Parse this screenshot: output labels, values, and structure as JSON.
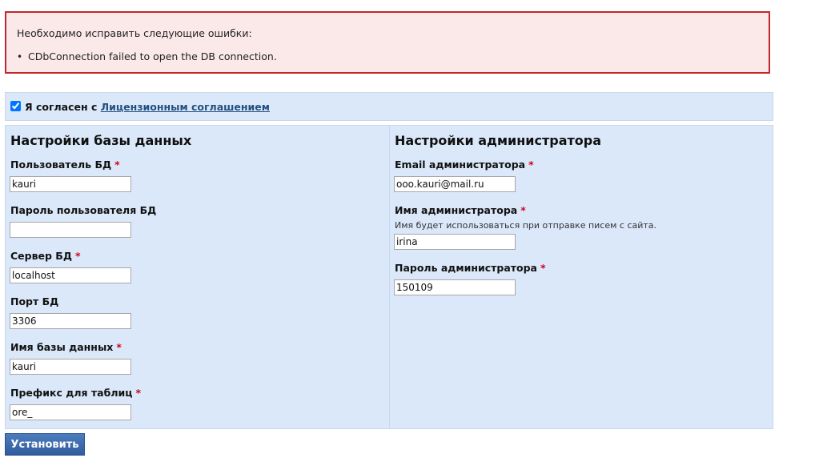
{
  "errors": {
    "title": "Необходимо исправить следующие ошибки:",
    "items": [
      "CDbConnection failed to open the DB connection."
    ]
  },
  "agreement": {
    "checked": true,
    "label": "Я согласен с",
    "link": "Лицензионным соглашением"
  },
  "db": {
    "title": "Настройки базы данных",
    "fields": [
      {
        "label": "Пользователь БД",
        "required": true,
        "value": "kauri"
      },
      {
        "label": "Пароль пользователя БД",
        "required": false,
        "value": ""
      },
      {
        "label": "Сервер БД",
        "required": true,
        "value": "localhost"
      },
      {
        "label": "Порт БД",
        "required": false,
        "value": "3306"
      },
      {
        "label": "Имя базы данных",
        "required": true,
        "value": "kauri"
      },
      {
        "label": "Префикс для таблиц",
        "required": true,
        "value": "ore_"
      }
    ]
  },
  "admin": {
    "title": "Настройки администратора",
    "fields": [
      {
        "label": "Email администратора",
        "required": true,
        "value": "ooo.kauri@mail.ru"
      },
      {
        "label": "Имя администратора",
        "required": true,
        "value": "irina",
        "hint": "Имя будет использоваться при отправке писем с сайта."
      },
      {
        "label": "Пароль администратора",
        "required": true,
        "value": "150109"
      }
    ]
  },
  "required_mark": "*",
  "submit_label": "Установить",
  "colors": {
    "error_border": "#c2272d",
    "error_bg": "#fbe9ea",
    "panel_bg": "#dbe8fa",
    "required": "#d0021b",
    "link": "#23507f",
    "button": "#3a68a8"
  }
}
